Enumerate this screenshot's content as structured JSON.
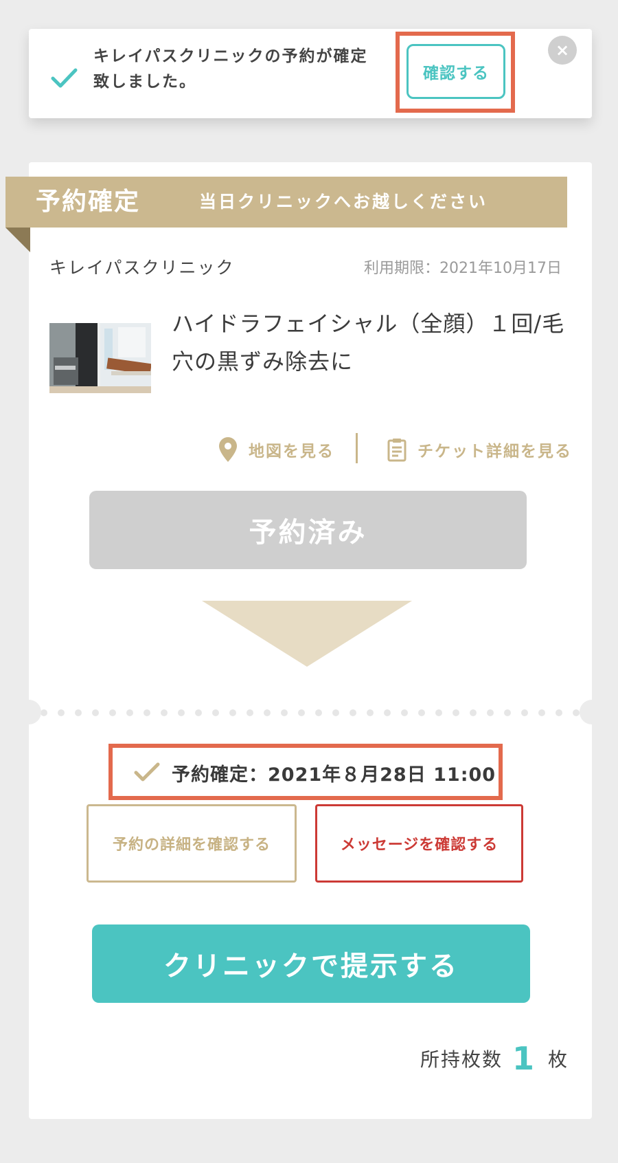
{
  "toast": {
    "message_line1": "キレイパスクリニックの予約が確定",
    "message_line2": "致しました。",
    "confirm_label": "確認する",
    "close_label": "×"
  },
  "ribbon": {
    "title": "予約確定",
    "subtitle": "当日クリニックへお越しください"
  },
  "ticket": {
    "clinic_name": "キレイパスクリニック",
    "expiry": "利用期限：2021年10月17日",
    "menu_line1": "ハイドラフェイシャル（全顔）１回/毛",
    "menu_line2": "穴の黒ずみ除去に",
    "map_link": "地図を見る",
    "detail_link": "チケット詳細を見る",
    "reserved_label": "予約済み"
  },
  "reservation": {
    "confirmed_text": "予約確定：2021年８月28日 11:00",
    "detail_button": "予約の詳細を確認する",
    "message_button": "メッセージを確認する"
  },
  "present_button": "クリニックで提示する",
  "holdings": {
    "label": "所持枚数",
    "count": "1",
    "unit": "枚"
  },
  "colors": {
    "accent_teal": "#4bc4c1",
    "gold": "#cbb88f",
    "highlight_red": "#e36a4d",
    "message_red": "#cc3a35",
    "disabled_gray": "#cfcfcf"
  },
  "icons": [
    "check-icon",
    "close-icon",
    "map-pin-icon",
    "clipboard-icon",
    "down-triangle-icon"
  ]
}
